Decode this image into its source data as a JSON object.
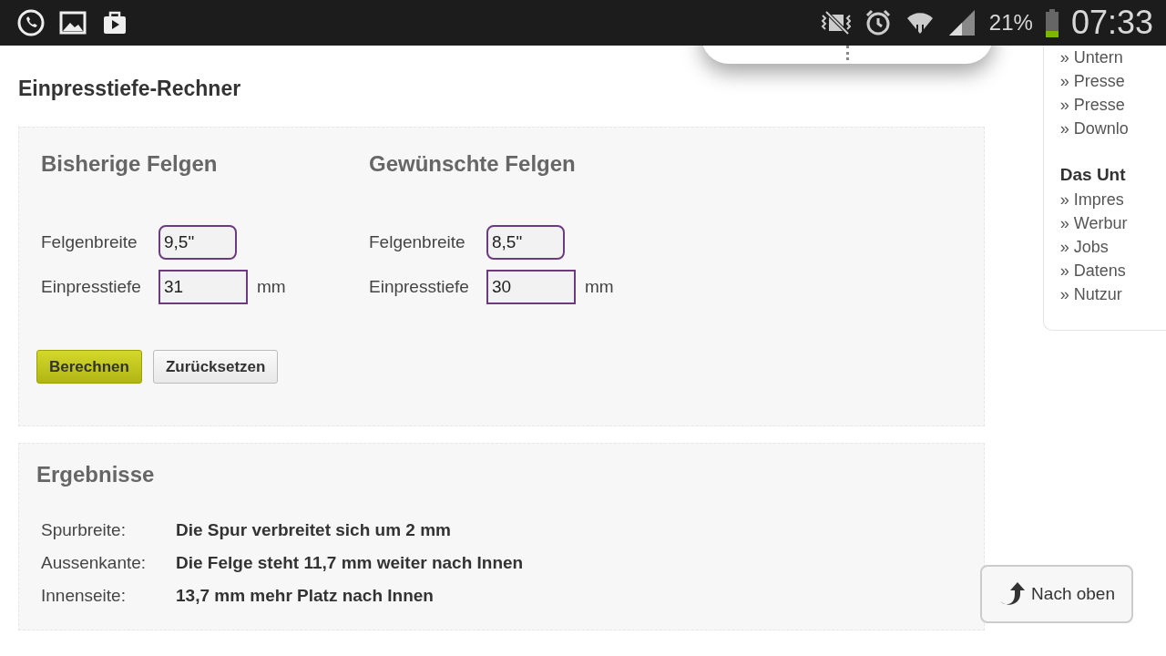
{
  "status_bar": {
    "battery": "21%",
    "time": "07:33"
  },
  "page_title": "Einpresstiefe-Rechner",
  "calculator": {
    "groups": [
      {
        "title": "Bisherige Felgen",
        "fields": [
          {
            "label": "Felgenbreite",
            "kind": "select",
            "value": "9,5\""
          },
          {
            "label": "Einpresstiefe",
            "kind": "input",
            "value": "31",
            "unit": "mm"
          }
        ]
      },
      {
        "title": "Gewünschte Felgen",
        "fields": [
          {
            "label": "Felgenbreite",
            "kind": "select",
            "value": "8,5\""
          },
          {
            "label": "Einpresstiefe",
            "kind": "input",
            "value": "30",
            "unit": "mm"
          }
        ]
      }
    ],
    "buttons": [
      {
        "label": "Berechnen",
        "kind": "primary"
      },
      {
        "label": "Zurücksetzen",
        "kind": "secondary"
      }
    ]
  },
  "results": {
    "title": "Ergebnisse",
    "rows": [
      {
        "label": "Spurbreite:",
        "value": "Die Spur verbreitet sich um 2 mm"
      },
      {
        "label": "Aussenkante:",
        "value": "Die Felge steht 11,7 mm weiter nach Innen"
      },
      {
        "label": "Innenseite:",
        "value": "13,7 mm mehr Platz nach Innen"
      }
    ]
  },
  "sidebar": {
    "items": [
      {
        "kind": "link",
        "text": "» Untern"
      },
      {
        "kind": "link",
        "text": "» Presse"
      },
      {
        "kind": "link",
        "text": "» Presse"
      },
      {
        "kind": "link",
        "text": "» Downlo"
      },
      {
        "kind": "heading",
        "text": "Das Unt"
      },
      {
        "kind": "link",
        "text": "» Impres"
      },
      {
        "kind": "link",
        "text": "» Werbur"
      },
      {
        "kind": "link",
        "text": "» Jobs"
      },
      {
        "kind": "link",
        "text": "» Datens"
      },
      {
        "kind": "link",
        "text": "» Nutzur"
      }
    ]
  },
  "back_to_top": {
    "label": "Nach oben"
  }
}
